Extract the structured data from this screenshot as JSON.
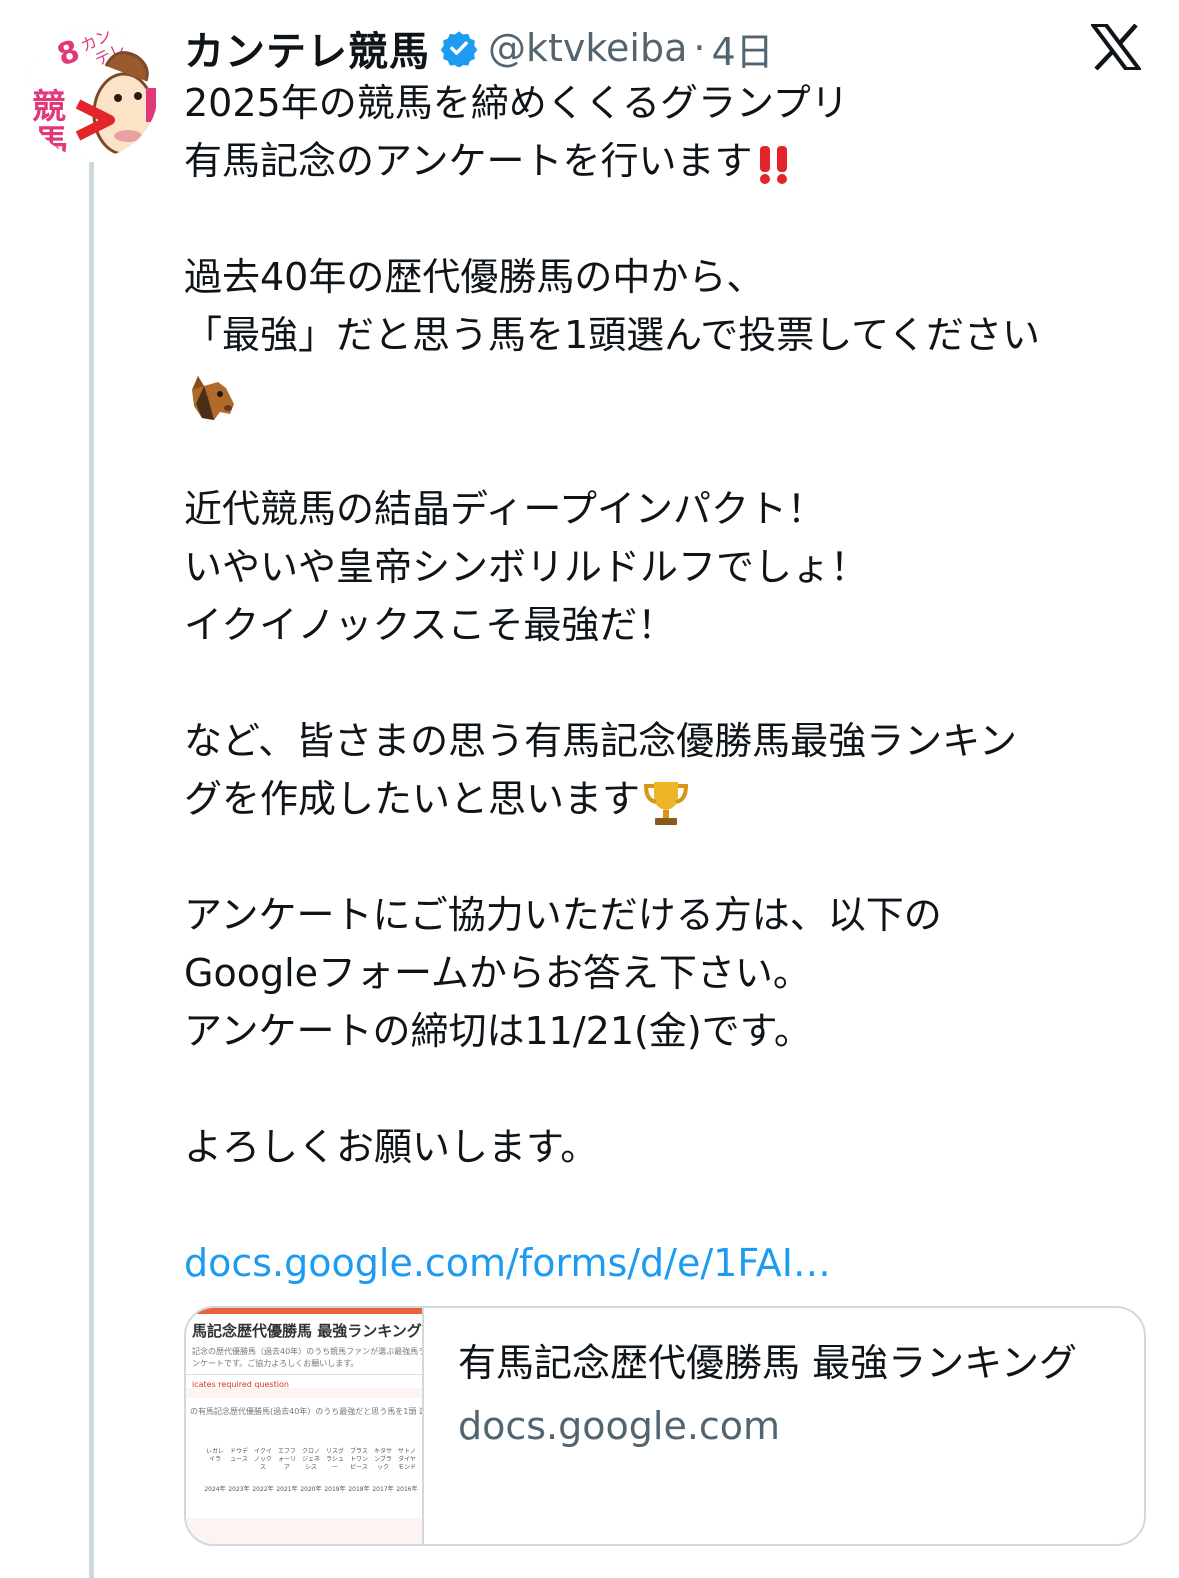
{
  "post": {
    "author": {
      "display_name": "カンテレ競馬",
      "handle": "@ktvkeiba",
      "separator": "·",
      "time": "4日"
    },
    "lines": [
      "2025年の競馬を締めくくるグランプリ",
      "有馬記念のアンケートを行います",
      "",
      "過去40年の歴代優勝馬の中から、",
      "「最強」だと思う馬を1頭選んで投票してください",
      "",
      "",
      "近代競馬の結晶ディープインパクト！",
      "いやいや皇帝シンボリルドルフでしょ！",
      "イクイノックスこそ最強だ！",
      "",
      "など、皆さまの思う有馬記念優勝馬最強ランキン",
      "グを作成したいと思います",
      "",
      "アンケートにご協力いただける方は、以下の",
      "Googleフォームからお答え下さい。",
      "アンケートの締切は11/21(金)です。",
      "",
      "よろしくお願いします。",
      "",
      "docs.google.com/forms/d/e/1FAI…"
    ],
    "link_url_text": "docs.google.com/forms/d/e/1FAI…"
  },
  "card": {
    "title": "有馬記念歴代優勝馬 最強ランキング",
    "domain": "docs.google.com",
    "thumbnail": {
      "title": "馬記念歴代優勝馬 最強ランキング",
      "desc1": "記念の歴代優勝馬（過去40年）のうち競馬ファンが選ぶ最強馬ランキングを決める",
      "desc2": "ンケートです。ご協力よろしくお願いします。",
      "required": "icates required question",
      "question": "の有馬記念歴代優勝馬(過去40年）のうち最強だと思う馬を1頭 選んでくだ",
      "horses": [
        "レガレイラ",
        "ドウデュース",
        "イクイノックス",
        "エフフォーリア",
        "クロノジェネシス",
        "リスグラシュー",
        "ブラストワンピース",
        "キタサンブラック",
        "サトノダイヤモンド"
      ],
      "years": [
        "2024年",
        "2023年",
        "2022年",
        "2021年",
        "2020年",
        "2019年",
        "2018年",
        "2017年",
        "2016年"
      ]
    }
  },
  "emoji": {
    "exclaim": "double-exclamation-icon",
    "horse": "horse-face-icon",
    "trophy": "trophy-icon"
  },
  "colors": {
    "text": "#0f1419",
    "muted": "#536471",
    "link": "#1d9bf0",
    "verified": "#1d9bf0",
    "border": "#cfd9de"
  }
}
